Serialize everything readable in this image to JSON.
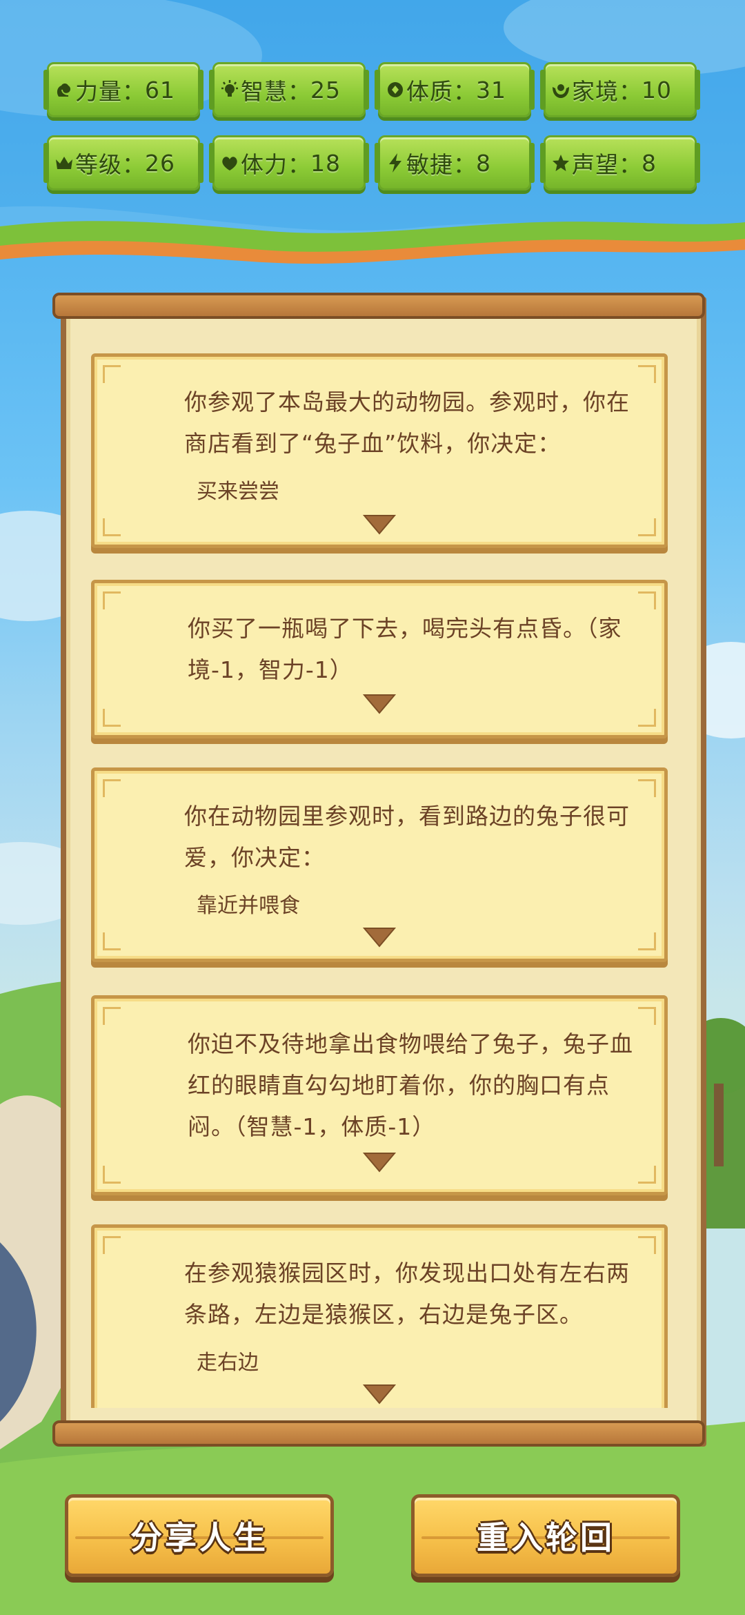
{
  "stats": [
    {
      "icon": "strength-icon",
      "label": "力量",
      "value": "61"
    },
    {
      "icon": "intelligence-icon",
      "label": "智慧",
      "value": "25"
    },
    {
      "icon": "constitution-icon",
      "label": "体质",
      "value": "31"
    },
    {
      "icon": "family-icon",
      "label": "家境",
      "value": "10"
    },
    {
      "icon": "crown-icon",
      "label": "等级",
      "value": "26"
    },
    {
      "icon": "stamina-icon",
      "label": "体力",
      "value": "18"
    },
    {
      "icon": "lightning-icon",
      "label": "敏捷",
      "value": "8"
    },
    {
      "icon": "star-icon",
      "label": "声望",
      "value": "8"
    }
  ],
  "stat_separator": "：",
  "events": [
    {
      "text": "你参观了本岛最大的动物园。参观时，你在商店看到了“兔子血”饮料，你决定：",
      "choice": "买来尝尝"
    },
    {
      "text": "你买了一瓶喝了下去，喝完头有点昏。（家境-1，智力-1）",
      "choice": ""
    },
    {
      "text": "你在动物园里参观时，看到路边的兔子很可爱，你决定：",
      "choice": "靠近并喂食"
    },
    {
      "text": "你迫不及待地拿出食物喂给了兔子，兔子血红的眼睛直勾勾地盯着你，你的胸口有点闷。（智慧-1，体质-1）",
      "choice": ""
    },
    {
      "text": "在参观猿猴园区时，你发现出口处有左右两条路，左边是猿猴区，右边是兔子区。",
      "choice": "走右边"
    }
  ],
  "buttons": {
    "share": "分享人生",
    "restart": "重入轮回"
  },
  "colors": {
    "stat_green": "#8ccb36",
    "card_bg": "#fbefb0",
    "card_text": "#6b4226",
    "button_yellow": "#f6c04a"
  }
}
